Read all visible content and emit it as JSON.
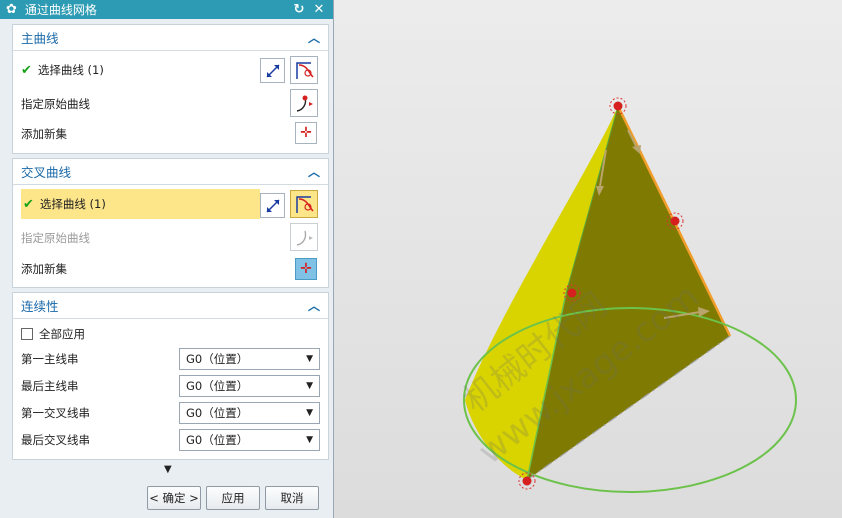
{
  "dialog": {
    "title": "通过曲线网格",
    "reset_icon": "reset-icon",
    "close_icon": "close-icon"
  },
  "primary": {
    "title": "主曲线",
    "select_curve": "选择曲线 (1)",
    "specify_origin": "指定原始曲线",
    "add_new_set": "添加新集"
  },
  "cross": {
    "title": "交叉曲线",
    "select_curve": "选择曲线 (1)",
    "specify_origin": "指定原始曲线",
    "add_new_set": "添加新集"
  },
  "continuity": {
    "title": "连续性",
    "apply_all": "全部应用",
    "rows": [
      {
        "label": "第一主线串",
        "value": "G0（位置）"
      },
      {
        "label": "最后主线串",
        "value": "G0（位置）"
      },
      {
        "label": "第一交叉线串",
        "value": "G0（位置）"
      },
      {
        "label": "最后交叉线串",
        "value": "G0（位置）"
      }
    ]
  },
  "footer": {
    "ok": "< 确定 >",
    "apply": "应用",
    "cancel": "取消"
  },
  "watermark": {
    "line1": "机械时代网",
    "line2": "www.jxage.com"
  },
  "colors": {
    "title_bar": "#2d9bb3",
    "highlight": "#fde58a",
    "section_title": "#1868a8",
    "cone_yellow": "#d9d400",
    "cone_dark": "#7d7a00",
    "base_circle": "#6cc24a"
  }
}
